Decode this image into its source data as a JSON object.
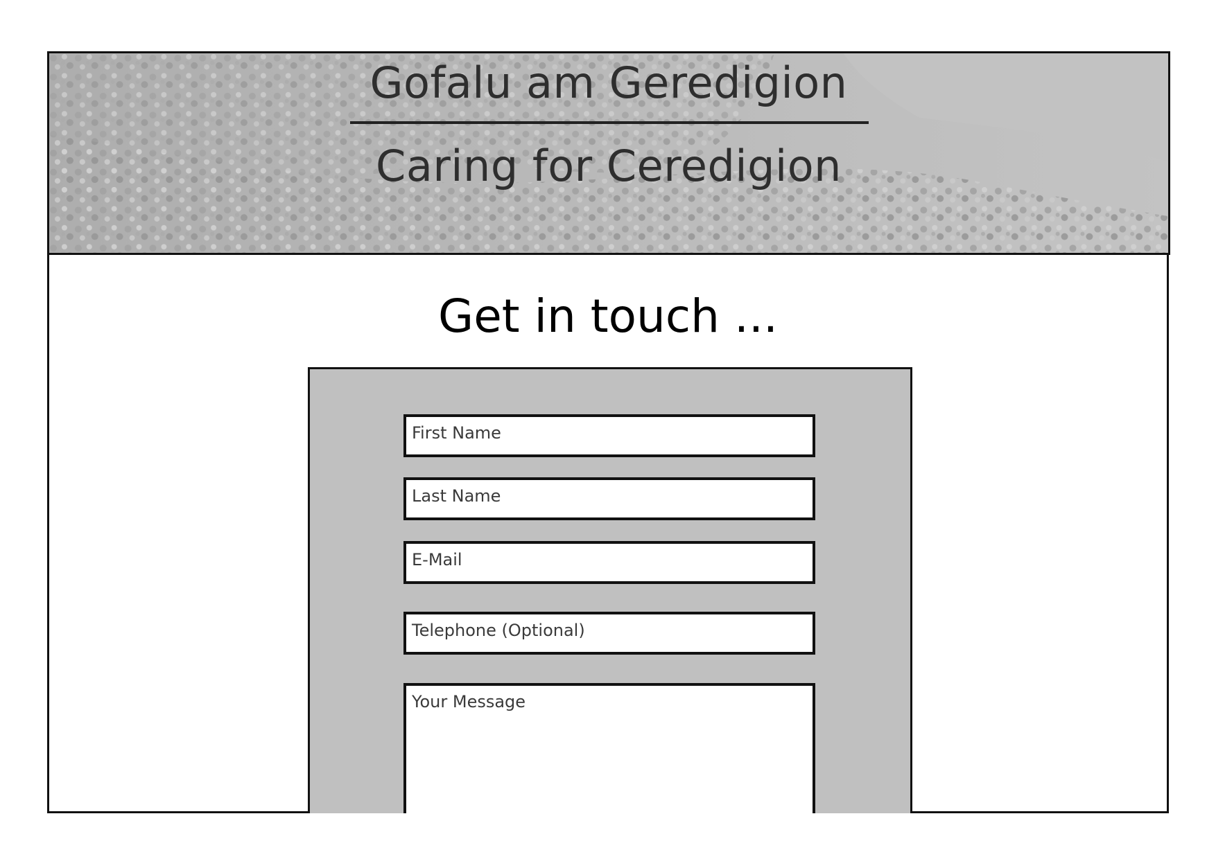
{
  "banner": {
    "title_welsh": "Gofalu am Geredigion",
    "title_english": "Caring for Ceredigion",
    "background_image": "coastal-gorse-photo-greyscale"
  },
  "main": {
    "heading": "Get in touch ..."
  },
  "form": {
    "first_name": {
      "placeholder": "First Name"
    },
    "last_name": {
      "placeholder": "Last Name"
    },
    "email": {
      "placeholder": "E-Mail"
    },
    "telephone": {
      "placeholder": "Telephone (Optional)"
    },
    "message": {
      "placeholder": "Your Message"
    }
  },
  "colors": {
    "panel": "#c0c0c0",
    "border": "#111111",
    "banner_text": "#2e2e2e"
  }
}
